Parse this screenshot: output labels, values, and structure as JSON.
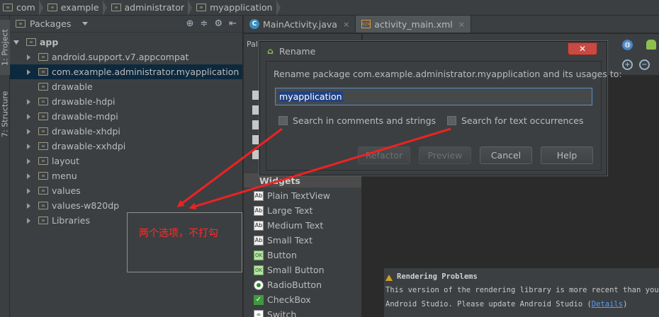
{
  "breadcrumb": [
    "com",
    "example",
    "administrator",
    "myapplication"
  ],
  "left_stripe": {
    "project_tab": "1: Project",
    "structure_tab": "7: Structure"
  },
  "project_panel": {
    "view_selector": "Packages",
    "tree": [
      {
        "label": "app",
        "expanded": true
      },
      {
        "label": "android.support.v7.appcompat"
      },
      {
        "label": "com.example.administrator.myapplication",
        "selected": true
      },
      {
        "label": "drawable"
      },
      {
        "label": "drawable-hdpi"
      },
      {
        "label": "drawable-mdpi"
      },
      {
        "label": "drawable-xhdpi"
      },
      {
        "label": "drawable-xxhdpi"
      },
      {
        "label": "layout"
      },
      {
        "label": "menu"
      },
      {
        "label": "values"
      },
      {
        "label": "values-w820dp"
      },
      {
        "label": "Libraries"
      }
    ]
  },
  "editor_tabs": [
    {
      "label": "MainActivity.java",
      "icon": "class-icon",
      "close": "×"
    },
    {
      "label": "activity_main.xml",
      "icon": "xml-file-icon",
      "close": "×",
      "active": true
    }
  ],
  "palette": {
    "header": "Pal",
    "widgets_header": "Widgets",
    "widgets": [
      {
        "label": "Plain TextView",
        "icon": "Ab"
      },
      {
        "label": "Large Text",
        "icon": "Ab"
      },
      {
        "label": "Medium Text",
        "icon": "Ab"
      },
      {
        "label": "Small Text",
        "icon": "Ab"
      },
      {
        "label": "Button",
        "icon": "OK"
      },
      {
        "label": "Small Button",
        "icon": "OK"
      },
      {
        "label": "RadioButton",
        "icon": ""
      },
      {
        "label": "CheckBox",
        "icon": "✓"
      },
      {
        "label": "Switch",
        "icon": "∞"
      }
    ]
  },
  "rename_dialog": {
    "title": "Rename",
    "close_glyph": "✕",
    "prompt": "Rename package com.example.administrator.myapplication and its usages to:",
    "input_value": "myapplication",
    "check_comments": "Search in comments and strings",
    "check_text": "Search for text occurrences",
    "buttons": {
      "refactor": "Refactor",
      "preview": "Preview",
      "cancel": "Cancel",
      "help": "Help"
    }
  },
  "rendering_problems": {
    "title": "Rendering Problems",
    "line1": "This version of the rendering library is more recent than your ve",
    "line2_prefix": "Android Studio. Please update Android Studio (",
    "link": "Details",
    "line2_suffix": ")"
  },
  "annotation": {
    "text": "两个选项，不打勾",
    "color": "#ff2b2b"
  }
}
